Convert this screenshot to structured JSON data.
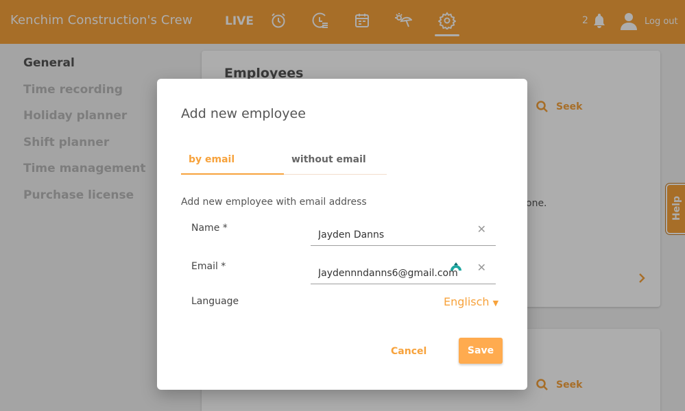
{
  "header": {
    "brand": "Kenchim Construction's Crew",
    "live_label": "LIVE",
    "notification_count": "2",
    "logout_label": "Log out"
  },
  "sidebar": {
    "items": [
      {
        "label": "General",
        "active": true
      },
      {
        "label": "Time recording"
      },
      {
        "label": "Holiday planner"
      },
      {
        "label": "Shift planner"
      },
      {
        "label": "Time management"
      },
      {
        "label": "Purchase license"
      }
    ]
  },
  "background": {
    "card_title": "Employees",
    "seek_label": "Seek",
    "partial_text": "one."
  },
  "help_label": "Help",
  "modal": {
    "title": "Add new employee",
    "tabs": [
      {
        "label": "by email",
        "active": true
      },
      {
        "label": "without email"
      }
    ],
    "description": "Add new employee with email address",
    "name_label": "Name *",
    "name_value": "Jayden Danns",
    "email_label": "Email *",
    "email_value": "Jaydennndanns6@gmail.com",
    "language_label": "Language",
    "language_value": "Englisch",
    "cancel_label": "Cancel",
    "save_label": "Save"
  },
  "colors": {
    "accent": "#f7a23b",
    "save_button": "#ffab4f"
  }
}
